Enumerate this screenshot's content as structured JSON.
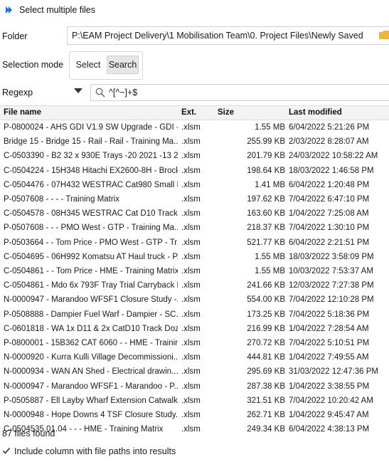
{
  "window": {
    "title": "Select multiple files",
    "icon": "app-icon"
  },
  "folder": {
    "label": "Folder",
    "value": "P:\\EAM Project Delivery\\1 Mobilisation Team\\0. Project Files\\Newly Saved",
    "icon": "folder-icon"
  },
  "selection_mode": {
    "label": "Selection mode",
    "options": [
      "Select",
      "Search"
    ],
    "active": "Search"
  },
  "regexp": {
    "label": "Regexp",
    "value": "^[^~]+$",
    "icon": "search-icon"
  },
  "table": {
    "columns": [
      "File name",
      "Ext.",
      "Size",
      "Last modified"
    ],
    "rows": [
      [
        "P-0800024 - AHS GDI V1.9 SW Upgrade - GDI -...",
        ".xlsm",
        "1.55 MB",
        "6/04/2022 5:21:26 PM"
      ],
      [
        "Bridge 15 - Bridge 15 - Rail - Rail - Training Ma...",
        ".xlsm",
        "255.99 KB",
        "2/03/2022 8:28:07 AM"
      ],
      [
        "C-0503390 - B2 32 x 930E Trays -20 2021 -13 20...",
        ".xlsm",
        "201.79 KB",
        "24/03/2022 10:58:22 AM"
      ],
      [
        "C-0504224 - 15H348 Hitachi EX2600-8H - Brock...",
        ".xlsm",
        "198.64 KB",
        "18/03/2022 1:46:58 PM"
      ],
      [
        "C-0504476 - 07H432 WESTRAC Cat980 Small FE...",
        ".xlsm",
        "1.41 MB",
        "6/04/2022 1:20:48 PM"
      ],
      [
        "P-0507608 - - - - Training Matrix",
        ".xlsm",
        "197.62 KB",
        "7/04/2022 6:47:10 PM"
      ],
      [
        "C-0504578 - 08H345 WESTRAC Cat D10 Track D...",
        ".xlsm",
        "163.60 KB",
        "1/04/2022 7:25:08 AM"
      ],
      [
        "P-0507608 - - - PMO West - GTP - Training Ma...",
        ".xlsm",
        "218.37 KB",
        "7/04/2022 1:30:10 PM"
      ],
      [
        "P-0503664 - - Tom Price - PMO West - GTP - Tr...",
        ".xlsm",
        "521.77 KB",
        "6/04/2022 2:21:51 PM"
      ],
      [
        "C-0504695 - 06H992 Komatsu AT Haul truck - P...",
        ".xlsm",
        "1.55 MB",
        "18/03/2022 3:58:09 PM"
      ],
      [
        "C-0504861 - - Tom Price - HME - Training Matrix",
        ".xlsm",
        "1.55 MB",
        "10/03/2022 7:53:37 AM"
      ],
      [
        "C-0504861 - Mdo 6x 793F Tray Trial Carryback E...",
        ".xlsm",
        "241.66 KB",
        "12/03/2022 7:27:38 PM"
      ],
      [
        "N-0000947 - Marandoo WFSF1 Closure Study -...",
        ".xlsm",
        "554.00 KB",
        "7/04/2022 12:10:28 PM"
      ],
      [
        "P-0508888 - Dampier Fuel Warf - Dampier - SC...",
        ".xlsm",
        "173.25 KB",
        "7/04/2022 5:18:36 PM"
      ],
      [
        "C-0601818 - WA 1x D11 & 2x CatD10 Track Doz...",
        ".xlsm",
        "216.99 KB",
        "1/04/2022 7:28:54 AM"
      ],
      [
        "P-0800001 - 15B362 CAT 6060 - - HME - Trainin...",
        ".xlsm",
        "270.72 KB",
        "7/04/2022 5:10:51 PM"
      ],
      [
        "N-0000920 - Kurra Kulli Village Decommissioni...",
        ".xlsm",
        "444.81 KB",
        "1/04/2022 7:49:55 AM"
      ],
      [
        "N-0000934 - WAN AN Shed - Electrical drawin...",
        ".xlsm",
        "295.69 KB",
        "31/03/2022 12:47:36 PM"
      ],
      [
        "N-0000947 - Marandoo WFSF1 - Marandoo - P...",
        ".xlsm",
        "287.38 KB",
        "1/04/2022 3:38:55 PM"
      ],
      [
        "P-0505887 - Ell Layby Wharf Extension Catwalk...",
        ".xlsm",
        "321.51 KB",
        "7/04/2022 10:20:42 AM"
      ],
      [
        "N-0000948 - Hope Downs 4 TSF Closure Study....",
        ".xlsm",
        "262.71 KB",
        "1/04/2022 9:45:47 AM"
      ],
      [
        "C-0504535.01.04 - - - HME - Training Matrix",
        ".xlsm",
        "249.34 KB",
        "6/04/2022 4:38:13 PM"
      ]
    ]
  },
  "status": {
    "text": "87 files found"
  },
  "include_paths": {
    "label": "Include column with file paths into results",
    "checked": true
  },
  "colors": {
    "accent": "#1f6fd0",
    "folder": "#f0b53a",
    "header_bg": "#f3f3f3",
    "active_button_bg": "#e6e6e6"
  }
}
